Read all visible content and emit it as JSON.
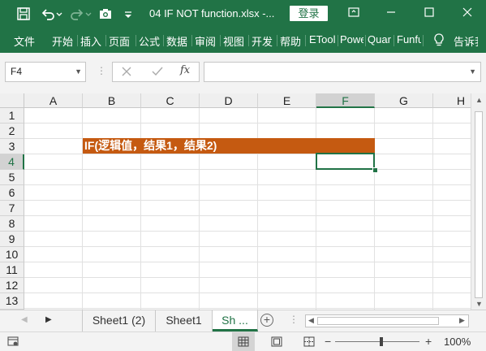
{
  "titlebar": {
    "title": "04 IF NOT function.xlsx  -...",
    "login_label": "登录",
    "bg_color": "#217346"
  },
  "ribbon": {
    "tabs": [
      "文件",
      "开始",
      "插入",
      "页面",
      "公式",
      "数据",
      "审阅",
      "视图",
      "开发",
      "帮助",
      "ETool",
      "Power",
      "Quar",
      "Funfu",
      "告诉我"
    ]
  },
  "formula_bar": {
    "name_box": "F4",
    "fx_label": "fx",
    "formula": ""
  },
  "grid": {
    "columns": [
      "A",
      "B",
      "C",
      "D",
      "E",
      "F",
      "G",
      "H"
    ],
    "selected_column": "F",
    "rows": [
      "1",
      "2",
      "3",
      "4",
      "5",
      "6",
      "7",
      "8",
      "9",
      "10",
      "11",
      "12",
      "13"
    ],
    "selected_row": "4",
    "banner_text": "IF(逻辑值，结果1，结果2)",
    "banner_color": "#c55a11"
  },
  "sheet_tabs": {
    "tabs": [
      "Sheet1 (2)",
      "Sheet1",
      "Sh ..."
    ],
    "active_tab": "Sh ...",
    "add_label": "+"
  },
  "status_bar": {
    "zoom": "100%",
    "zoom_minus": "−",
    "zoom_plus": "+"
  }
}
